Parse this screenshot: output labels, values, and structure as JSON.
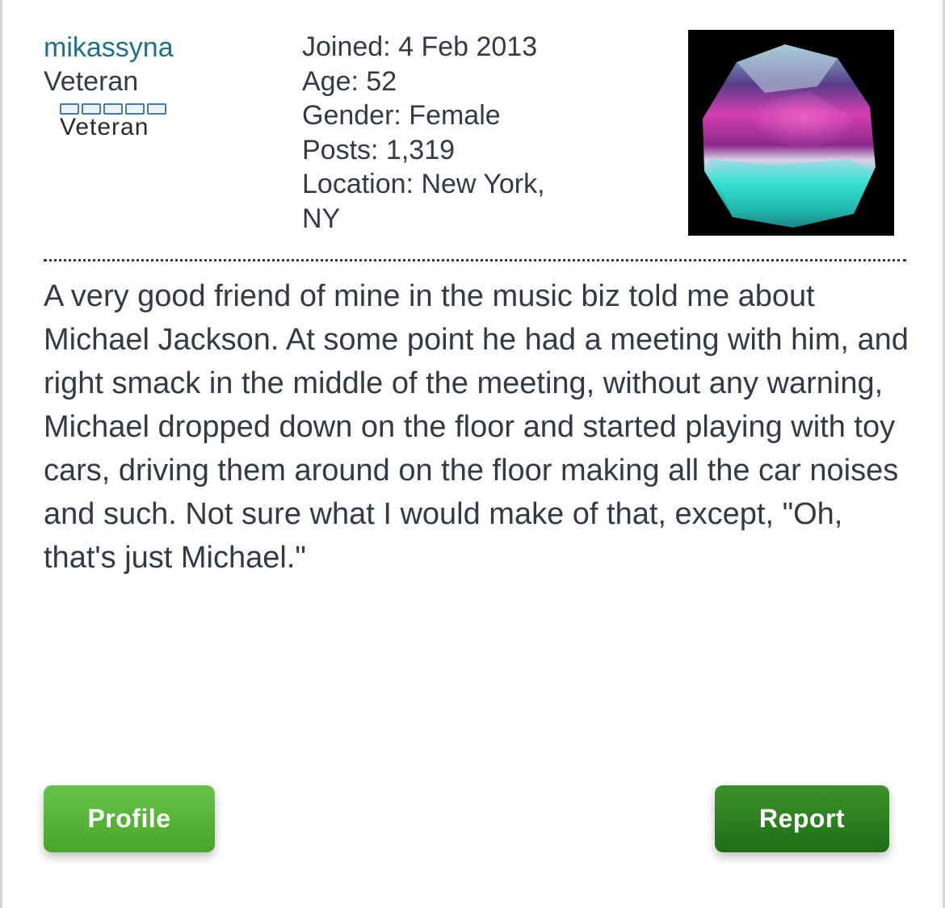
{
  "post": {
    "author": {
      "username": "mikassyna",
      "title": "Veteran",
      "rank_label": "Veteran",
      "rank_boxes": 5
    },
    "author_info": [
      "Joined: 4 Feb 2013",
      "Age: 52",
      "Gender: Female",
      "Posts: 1,319",
      "Location: New York,",
      "NY"
    ],
    "avatar_icon": "crystal-mineral-avatar",
    "body": "A very good friend of mine in the music biz told me about Michael Jackson. At some point he had a meeting with him, and right smack in the middle of the meeting, without any warning, Michael dropped down on the floor and started playing with toy cars, driving them around on the floor making all the car noises and such. Not sure what I would make of that, except, \"Oh, that's just Michael.\""
  },
  "actions": {
    "profile_label": "Profile",
    "report_label": "Report"
  },
  "colors": {
    "username": "#1f6f8f",
    "text": "#333a44",
    "profile_button": "#55b237",
    "report_button": "#2a7f20"
  }
}
